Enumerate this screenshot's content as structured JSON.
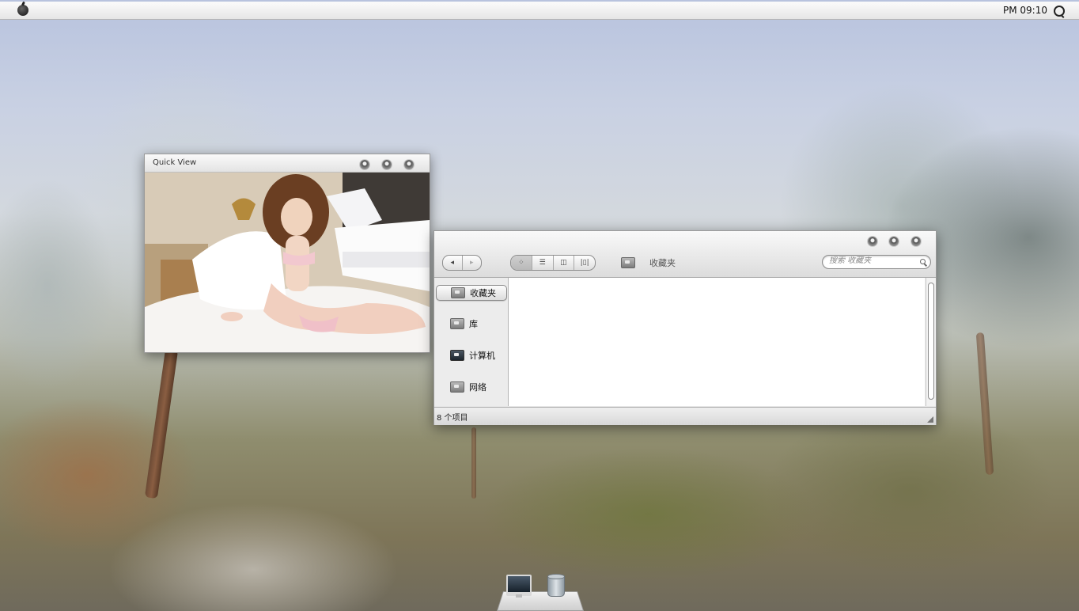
{
  "menubar": {
    "apple_icon": "apple-logo-icon",
    "clock": "PM 09:10",
    "search_icon": "spotlight-icon"
  },
  "quick_view": {
    "title": "Quick View",
    "buttons": [
      "close-button",
      "minimize-button",
      "zoom-button"
    ]
  },
  "finder": {
    "toolbar": {
      "back_icon": "chevron-left-icon",
      "forward_icon": "chevron-right-icon",
      "view_modes": [
        {
          "icon": "icon-view-icon",
          "glyph": "⁘",
          "active": true
        },
        {
          "icon": "list-view-icon",
          "glyph": "☰",
          "active": false
        },
        {
          "icon": "column-view-icon",
          "glyph": "◫",
          "active": false
        },
        {
          "icon": "coverflow-view-icon",
          "glyph": "|▯|",
          "active": false
        }
      ],
      "path_label": "收藏夹",
      "search_placeholder": "搜索 收藏夹"
    },
    "sidebar": [
      {
        "label": "收藏夹",
        "icon": "favorites-folder-icon",
        "selected": true
      },
      {
        "label": "库",
        "icon": "library-folder-icon",
        "selected": false
      },
      {
        "label": "计算机",
        "icon": "computer-icon",
        "selected": false
      },
      {
        "label": "网络",
        "icon": "network-folder-icon",
        "selected": false
      }
    ],
    "status": "8 个项目"
  },
  "dock": {
    "items": [
      {
        "name": "imac",
        "icon": "imac-icon"
      },
      {
        "name": "trash",
        "icon": "trash-icon"
      }
    ]
  },
  "colors": {
    "window_chrome": "#ececec",
    "menubar": "#f4f4f4",
    "selected_item": "#dcdcdc"
  }
}
